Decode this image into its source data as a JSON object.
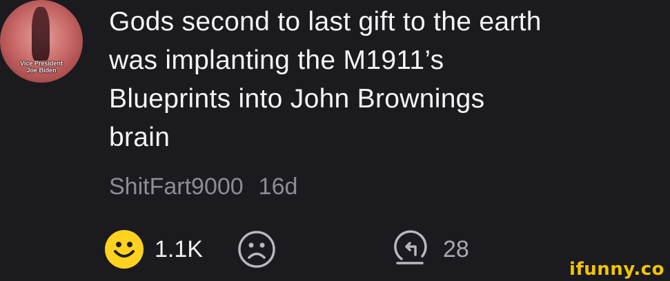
{
  "avatar": {
    "caption_line1": "Vice President",
    "caption_line2": "Joe Biden"
  },
  "comment": {
    "text": "Gods second to last gift to the earth\nwas implanting the M1911’s\nBlueprints into John Brownings\nbrain"
  },
  "meta": {
    "username": "ShitFart9000",
    "age": "16d"
  },
  "actions": {
    "smile_icon": "smile-face-icon",
    "smile_count": "1.1K",
    "frown_icon": "frown-face-icon",
    "reply_icon": "reply-arrow-icon",
    "reply_count": "28"
  },
  "watermark": {
    "text": "ifunny.co"
  },
  "colors": {
    "background": "#1b1b1f",
    "smile": "#ffd21f",
    "watermark": "#f2c500",
    "muted": "#8d8d94"
  }
}
